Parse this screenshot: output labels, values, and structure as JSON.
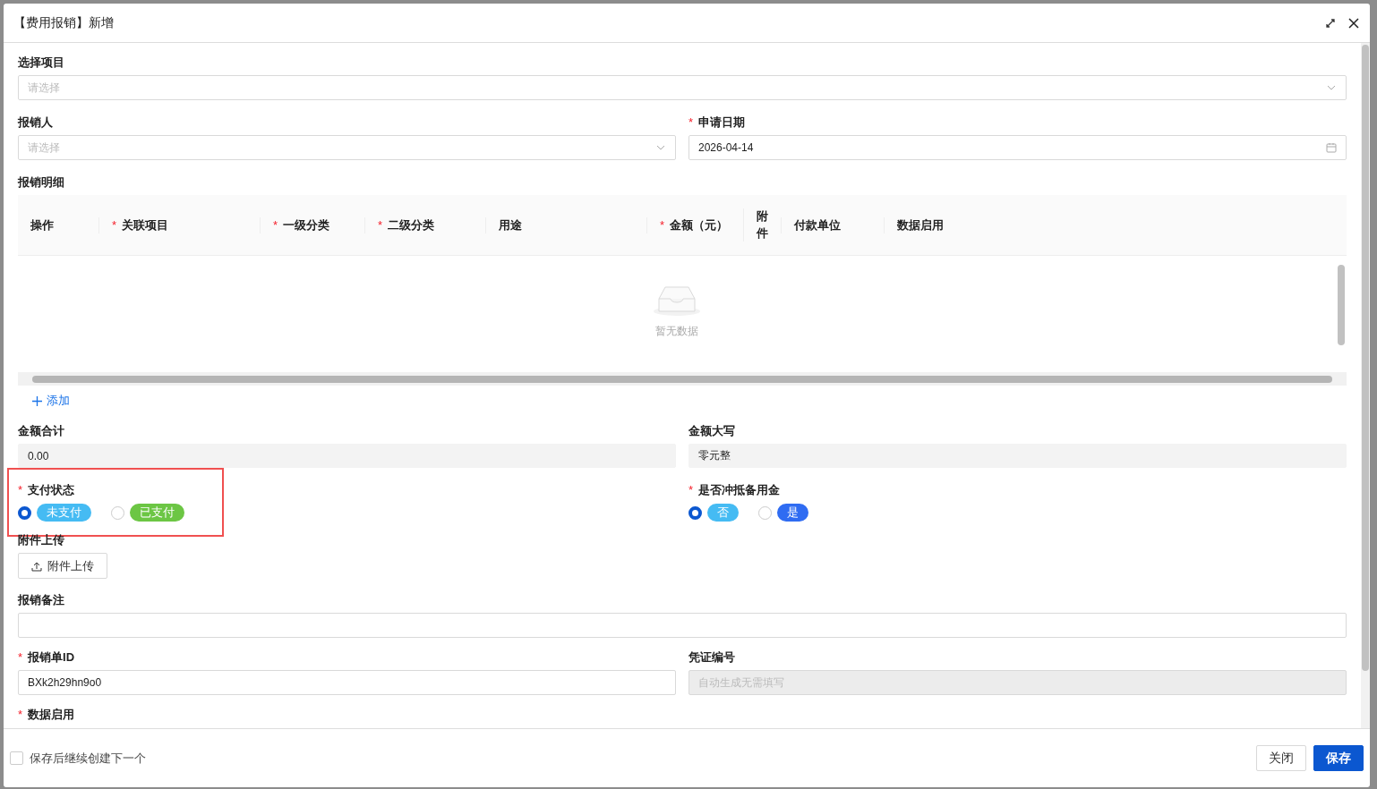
{
  "dialog": {
    "title": "【费用报销】新增"
  },
  "project": {
    "label": "选择项目",
    "placeholder": "请选择"
  },
  "claimant": {
    "label": "报销人",
    "placeholder": "请选择"
  },
  "apply_date": {
    "label": "申请日期",
    "required_mark": "*",
    "value": "2026-04-14"
  },
  "details": {
    "label": "报销明细",
    "columns": [
      {
        "label": "操作"
      },
      {
        "label": "关联项目",
        "required_mark": "*"
      },
      {
        "label": "一级分类",
        "required_mark": "*"
      },
      {
        "label": "二级分类",
        "required_mark": "*"
      },
      {
        "label": "用途"
      },
      {
        "label": "金额（元）",
        "required_mark": "*"
      },
      {
        "label": "附件"
      },
      {
        "label": "付款单位"
      },
      {
        "label": "数据启用"
      }
    ],
    "empty_text": "暂无数据",
    "add_label": "添加"
  },
  "total": {
    "label": "金额合计",
    "value": "0.00"
  },
  "total_upper": {
    "label": "金额大写",
    "value": "零元整"
  },
  "payment_status": {
    "label": "支付状态",
    "required_mark": "*",
    "highlighted": true,
    "options": [
      {
        "label": "未支付",
        "color": "#45bbf3",
        "selected": true
      },
      {
        "label": "已支付",
        "color": "#6cc644",
        "selected": false
      }
    ]
  },
  "offset_reserve": {
    "label": "是否冲抵备用金",
    "required_mark": "*",
    "options": [
      {
        "label": "否",
        "color": "#45bbf3",
        "selected": true
      },
      {
        "label": "是",
        "color": "#2f6cf2",
        "selected": false
      }
    ]
  },
  "attachment": {
    "label": "附件上传",
    "button": "附件上传"
  },
  "remark": {
    "label": "报销备注"
  },
  "claim_id": {
    "label": "报销单ID",
    "required_mark": "*",
    "value": "BXk2h29hn9o0"
  },
  "voucher": {
    "label": "凭证编号",
    "placeholder": "自动生成无需填写",
    "disabled": true
  },
  "data_enabled": {
    "label": "数据启用",
    "required_mark": "*"
  },
  "footer": {
    "continue": {
      "label": "保存后继续创建下一个",
      "checked": false
    },
    "buttons": [
      {
        "label": "关闭",
        "kind": "default"
      },
      {
        "label": "保存",
        "kind": "primary"
      }
    ]
  }
}
